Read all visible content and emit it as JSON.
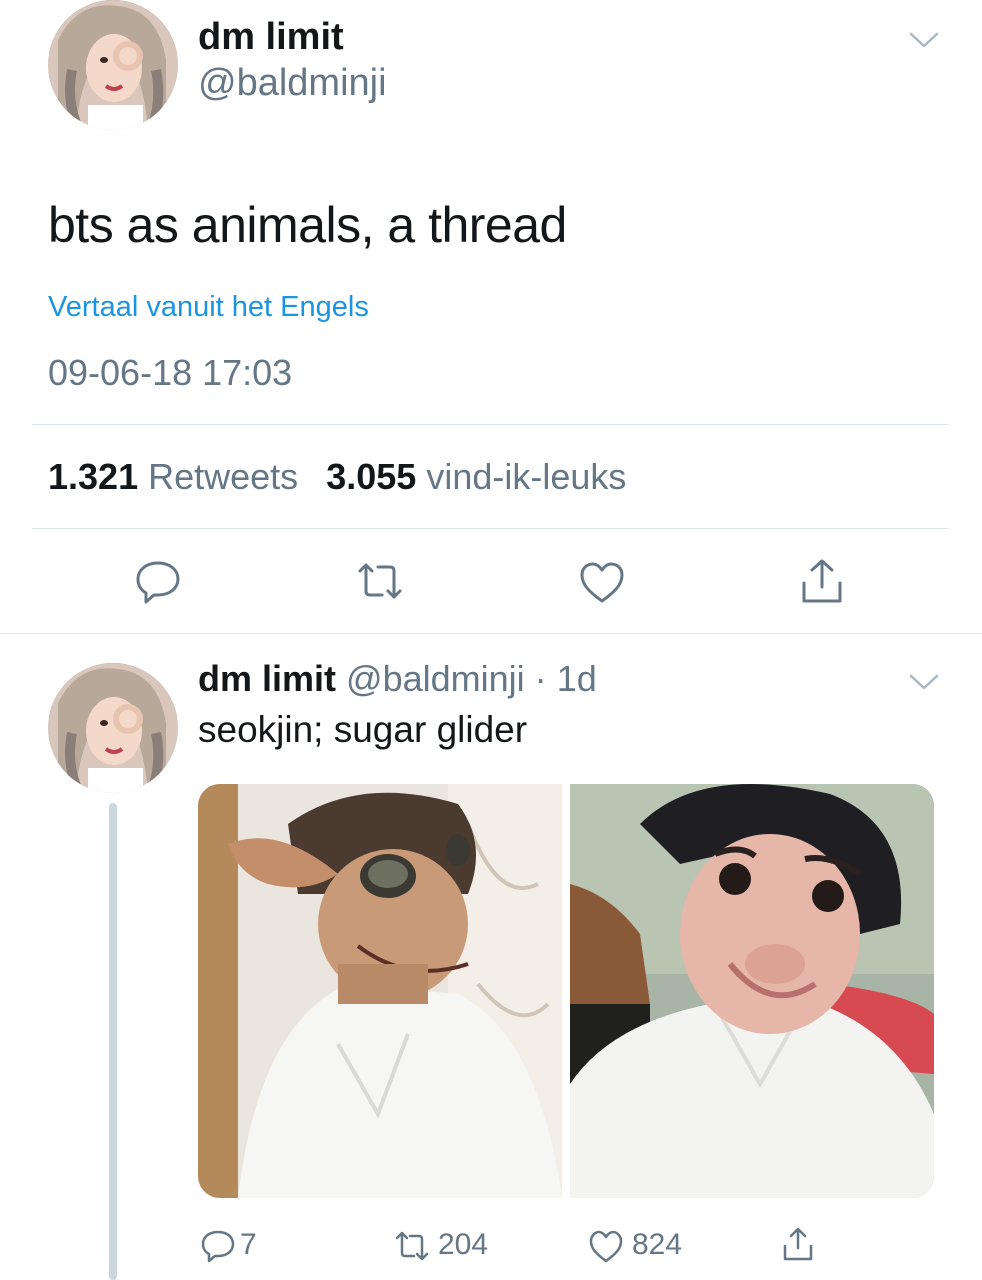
{
  "main_tweet": {
    "display_name": "dm limit",
    "handle": "@baldminji",
    "text": "bts as animals, a thread",
    "translate_link": "Vertaal vanuit het Engels",
    "timestamp": "09-06-18 17:03",
    "retweet_count": "1.321",
    "retweet_label": "Retweets",
    "like_count": "3.055",
    "like_label": "vind-ik-leuks"
  },
  "reply_tweet": {
    "display_name": "dm limit",
    "handle": "@baldminji",
    "separator": "·",
    "age": "1d",
    "text": "seokjin; sugar glider",
    "reply_count": "7",
    "retweet_count": "204",
    "like_count": "824"
  },
  "colors": {
    "link": "#1b95e0",
    "secondary_text": "#657786",
    "divider": "#e1e8ed",
    "thread_line": "#ccd6dd"
  },
  "icons": [
    "chevron-down-icon",
    "reply-icon",
    "retweet-icon",
    "like-icon",
    "share-icon"
  ]
}
